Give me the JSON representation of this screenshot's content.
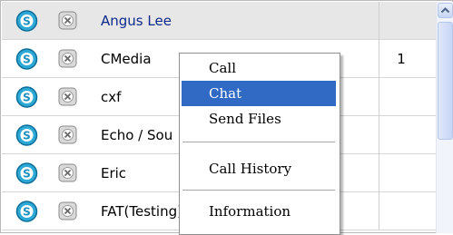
{
  "contacts": [
    {
      "name": "Angus Lee",
      "count": "",
      "selected": true
    },
    {
      "name": "CMedia",
      "count": "1",
      "selected": false
    },
    {
      "name": "cxf",
      "count": "",
      "selected": false
    },
    {
      "name": "Echo / Sou",
      "count": "",
      "selected": false
    },
    {
      "name": "Eric",
      "count": "",
      "selected": false
    },
    {
      "name": "FAT(Testing)",
      "count": "",
      "selected": false
    }
  ],
  "context_menu": {
    "call": "Call",
    "chat": "Chat",
    "send_files": "Send Files",
    "call_history": "Call History",
    "information": "Information",
    "highlighted": "Chat"
  },
  "colors": {
    "menu_highlight": "#316ac5",
    "selected_row": "#e7e7e7",
    "skype_icon": "#2ea9d6"
  },
  "icons": {
    "status": "skype-status-icon",
    "remove": "remove-contact-icon",
    "scroll_up": "scroll-up-arrow-icon"
  }
}
